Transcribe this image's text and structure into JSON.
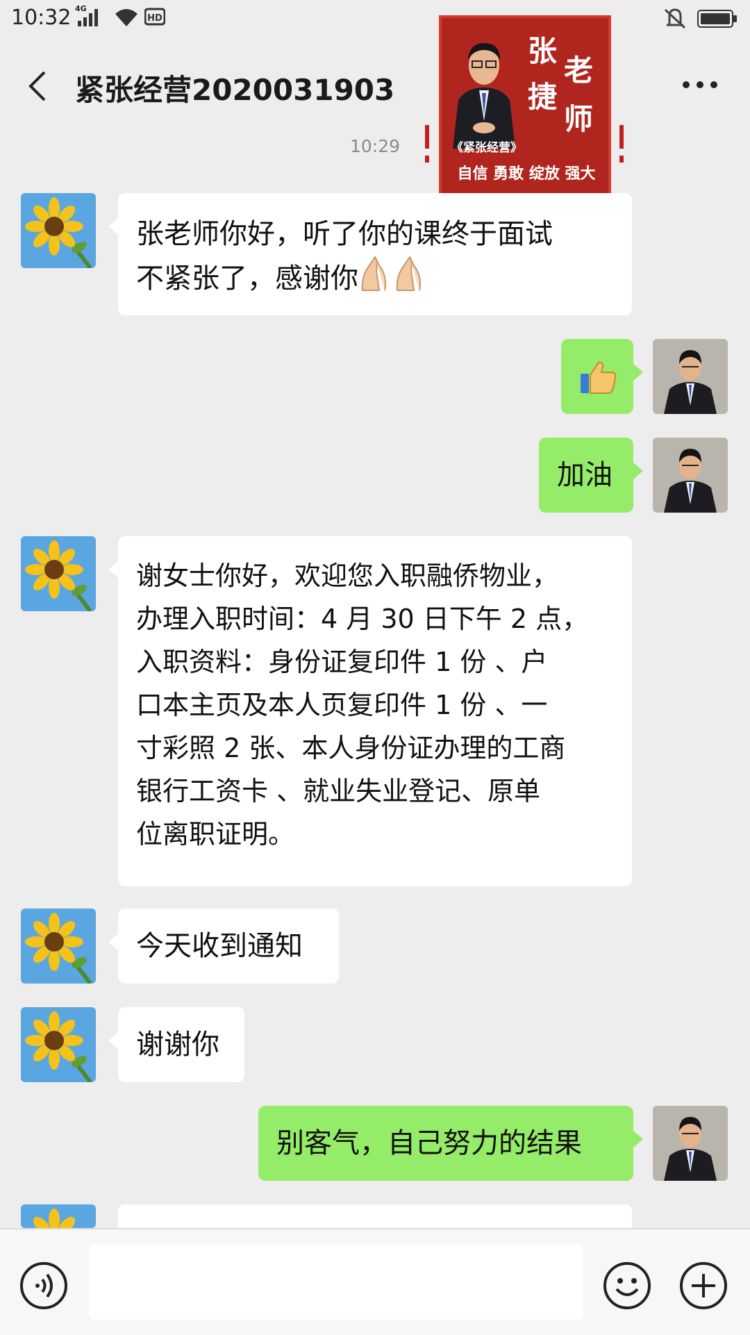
{
  "status_bar": {
    "time": "10:32",
    "network": "4G",
    "icons": [
      "signal-icon",
      "wifi-icon",
      "hd-icon",
      "bell-icon",
      "battery-icon"
    ]
  },
  "header": {
    "title": "紧张经营2020031903",
    "back_icon": "back-icon",
    "more_icon": "more-icon"
  },
  "banner": {
    "name_chars": [
      "张",
      "老",
      "捷",
      "师"
    ],
    "subtitle": "《紧张经营》",
    "slogan": "自信 勇敢 绽放 强大"
  },
  "timestamp": "10:29",
  "messages": [
    {
      "sender": "other",
      "text": "张老师你好，听了你的课终于面试\n不紧张了，感谢你",
      "emoji": "pray-emoji"
    },
    {
      "sender": "self",
      "text": "",
      "emoji": "thumbs-up-emoji"
    },
    {
      "sender": "self",
      "text": "加油"
    },
    {
      "sender": "other",
      "text": "谢女士你好，欢迎您入职融侨物业，\n办理入职时间：4 月 30 日下午 2 点，\n入职资料：身份证复印件 1 份 、户\n口本主页及本人页复印件 1 份 、一\n寸彩照 2 张、本人身份证办理的工商\n银行工资卡 、就业失业登记、原单\n位离职证明。"
    },
    {
      "sender": "other",
      "text": "今天收到通知"
    },
    {
      "sender": "other",
      "text": "谢谢你"
    },
    {
      "sender": "self",
      "text": "别客气，自己努力的结果"
    }
  ],
  "input_bar": {
    "placeholder": "",
    "voice_icon": "voice-icon",
    "emoji_icon": "emoji-icon",
    "plus_icon": "plus-icon"
  },
  "colors": {
    "background": "#ededed",
    "self_bubble": "#95ec69",
    "other_bubble": "#ffffff",
    "banner_red": "#b0261e"
  }
}
